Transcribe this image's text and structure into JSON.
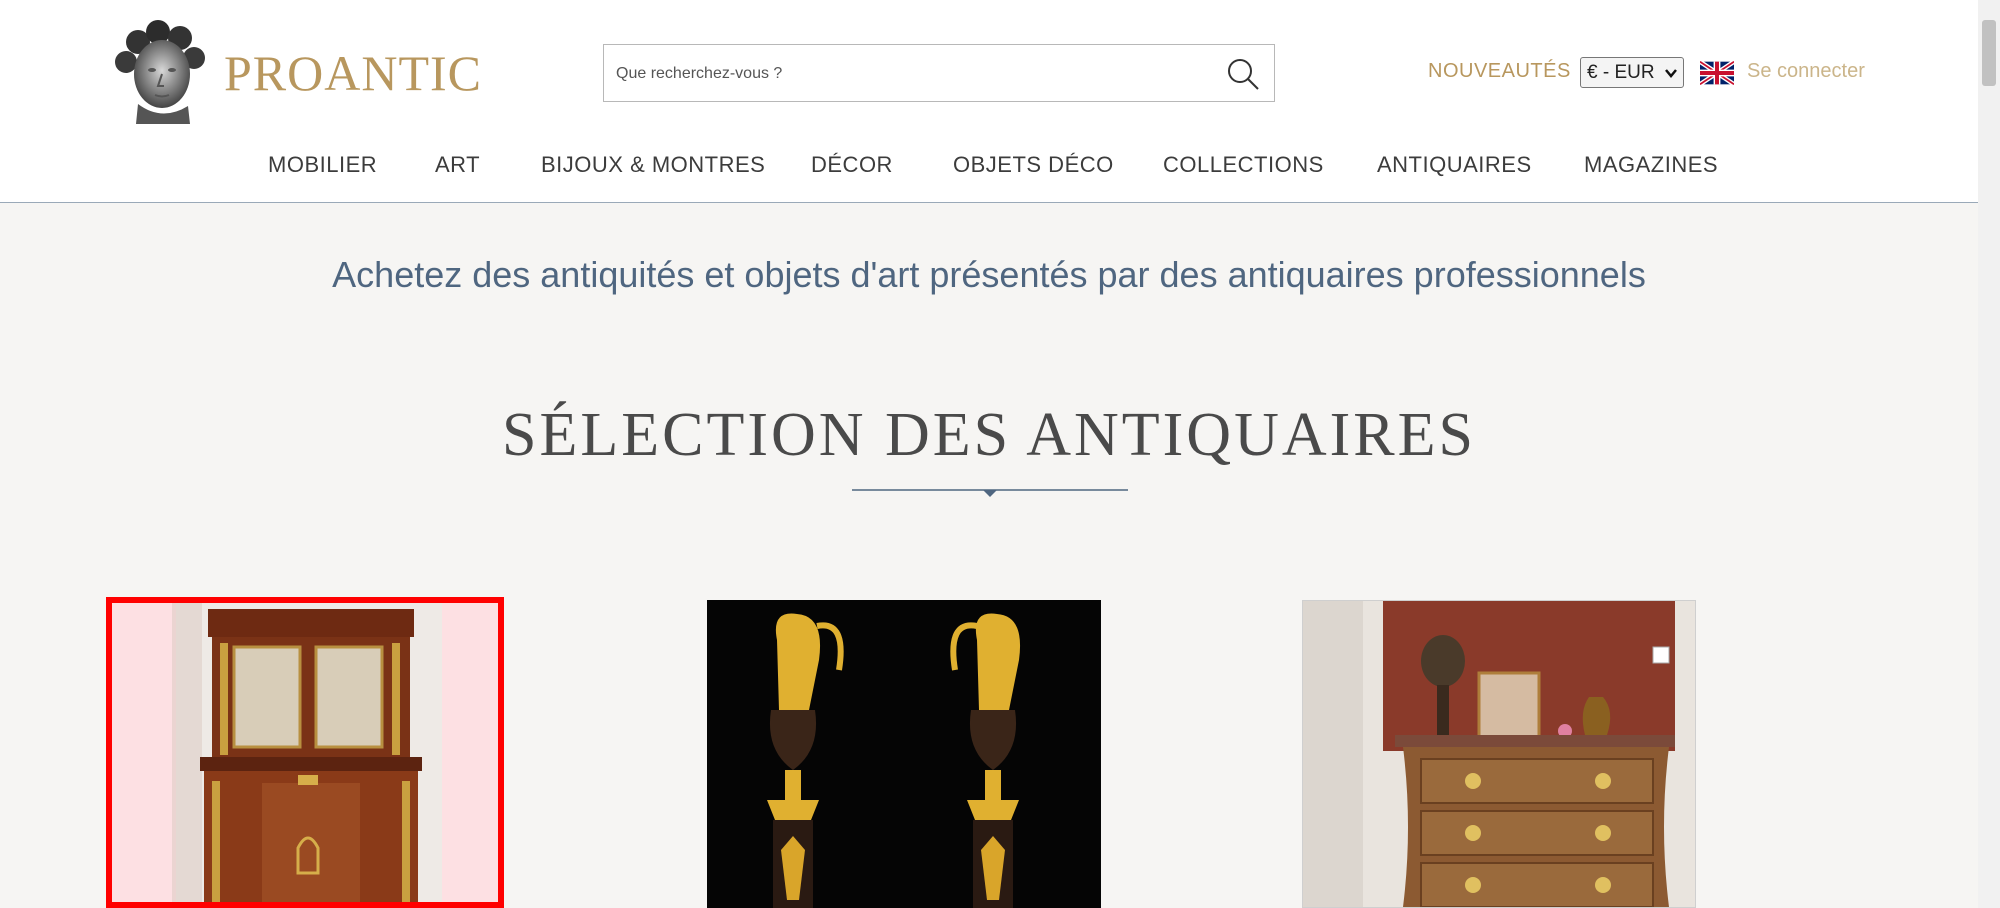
{
  "header": {
    "logo_text": "PROANTIC",
    "logo_icon": "bust-icon",
    "search_placeholder": "Que recherchez-vous ?",
    "nouveautes": "NOUVEAUTÉS",
    "currency_selected": "€ - EUR",
    "language_icon": "uk-flag-icon",
    "login": "Se connecter"
  },
  "nav": {
    "items": [
      {
        "label": "MOBILIER"
      },
      {
        "label": "ART"
      },
      {
        "label": "BIJOUX & MONTRES"
      },
      {
        "label": "DÉCOR"
      },
      {
        "label": "OBJETS DÉCO"
      },
      {
        "label": "COLLECTIONS"
      },
      {
        "label": "ANTIQUAIRES"
      },
      {
        "label": "MAGAZINES"
      }
    ]
  },
  "main": {
    "tagline": "Achetez des antiquités et objets d'art présentés par des antiquaires professionnels",
    "section_title": "SÉLECTION DES ANTIQUAIRES"
  },
  "products": [
    {
      "image": "mahogany-secretary-cabinet"
    },
    {
      "image": "pair-of-gilt-bronze-ewers"
    },
    {
      "image": "marquetry-commode-with-decor"
    }
  ],
  "colors": {
    "brand_gold": "#b8975e",
    "tagline_blue": "#4f6680",
    "background": "#f6f5f3",
    "selection_red": "#ff0000"
  }
}
